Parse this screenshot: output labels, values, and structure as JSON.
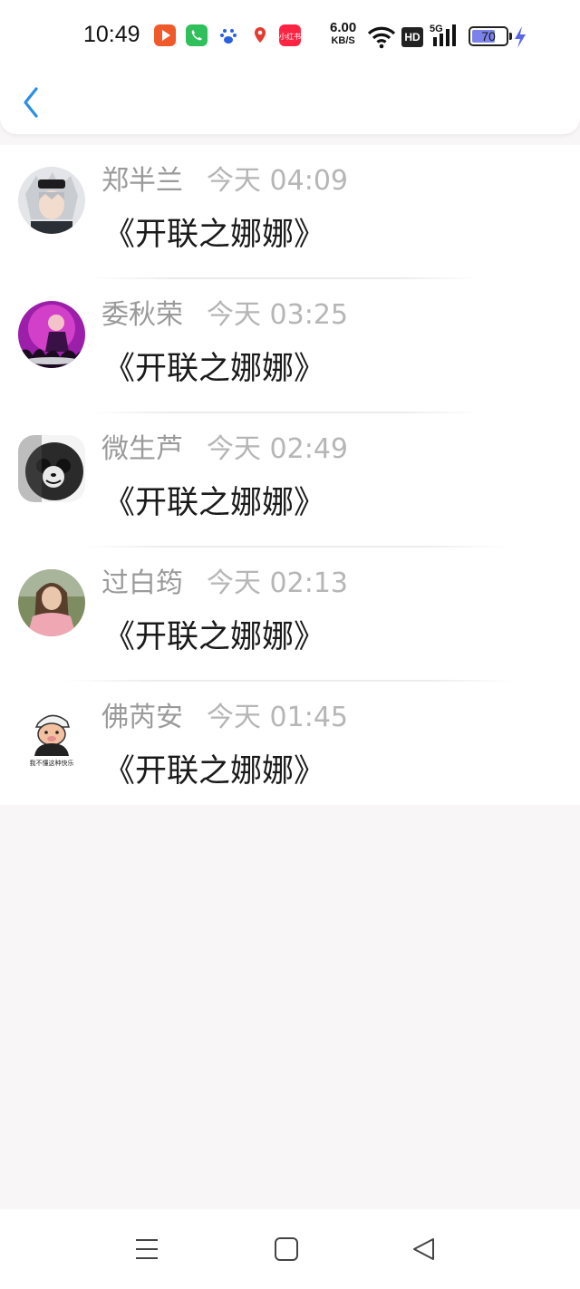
{
  "status_bar": {
    "time": "10:49",
    "net_speed_value": "6.00",
    "net_speed_unit": "KB/S",
    "hd_label": "HD",
    "network_label": "5G",
    "battery_level": "70",
    "app_icons": [
      "video-app-icon",
      "phone-app-icon",
      "baidu-app-icon",
      "map-app-icon",
      "xiaohongshu-app-icon"
    ],
    "xiaohongshu_label": "小红书"
  },
  "header": {
    "back_icon": "chevron-left-icon",
    "accent": "#2a8fe8"
  },
  "messages": [
    {
      "name": "郑半兰",
      "time": "今天 04:09",
      "text": "《开联之娜娜》"
    },
    {
      "name": "委秋荣",
      "time": "今天 03:25",
      "text": "《开联之娜娜》"
    },
    {
      "name": "微生芦",
      "time": "今天 02:49",
      "text": "《开联之娜娜》"
    },
    {
      "name": "过白筠",
      "time": "今天 02:13",
      "text": "《开联之娜娜》"
    },
    {
      "name": "佛芮安",
      "time": "今天 01:45",
      "text": "《开联之娜娜》"
    }
  ],
  "avatar5_caption": "我不懂这种快乐",
  "nav_bar": {
    "icons": [
      "menu-icon",
      "home-icon",
      "back-triangle-icon"
    ]
  }
}
